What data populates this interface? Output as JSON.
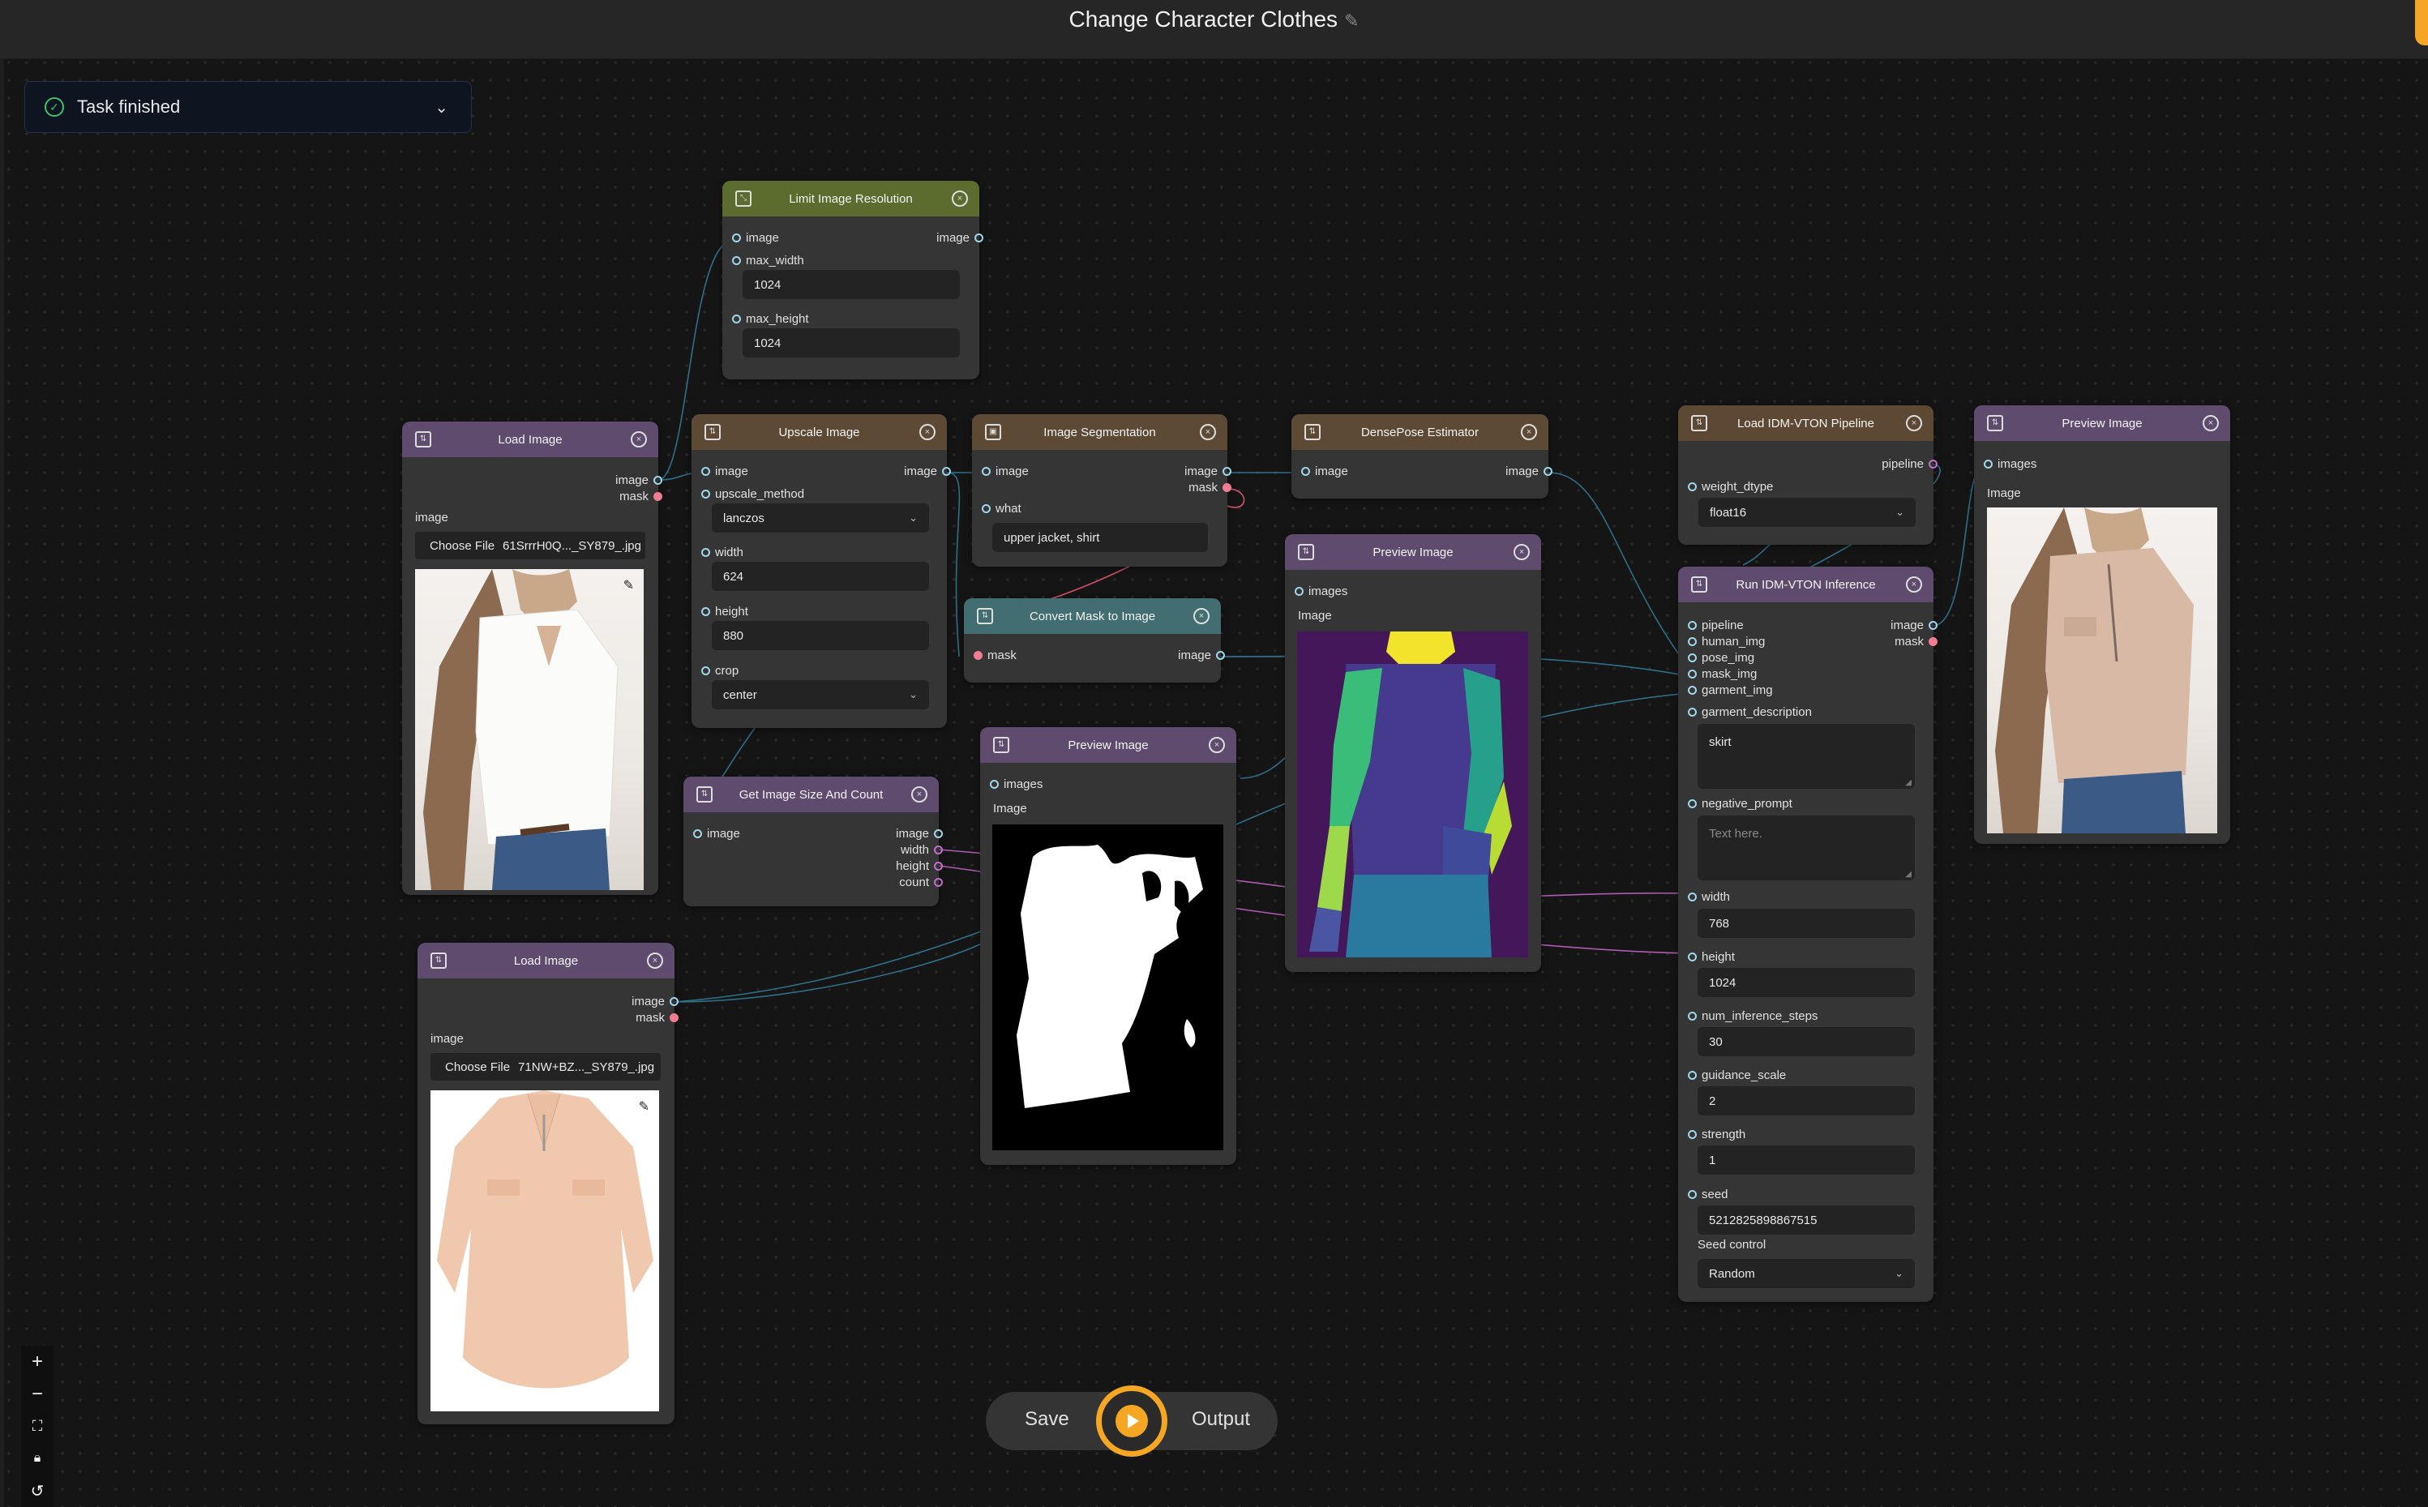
{
  "app": {
    "title": "Change Character Clothes"
  },
  "status": {
    "text": "Task finished"
  },
  "toolbar": {
    "save": "Save",
    "output": "Output"
  },
  "nodes": {
    "limit": {
      "title": "Limit Image Resolution",
      "in_image": "image",
      "out_image": "image",
      "max_width_label": "max_width",
      "max_width": "1024",
      "max_height_label": "max_height",
      "max_height": "1024"
    },
    "load1": {
      "title": "Load Image",
      "out_image": "image",
      "out_mask": "mask",
      "image_label": "image",
      "choose": "Choose File",
      "file": "61SrrrH0Q..._SY879_.jpg"
    },
    "upscale": {
      "title": "Upscale Image",
      "in_image": "image",
      "out_image": "image",
      "method_label": "upscale_method",
      "method": "lanczos",
      "width_label": "width",
      "width": "624",
      "height_label": "height",
      "height": "880",
      "crop_label": "crop",
      "crop": "center"
    },
    "seg": {
      "title": "Image Segmentation",
      "in_image": "image",
      "out_image": "image",
      "out_mask": "mask",
      "what_label": "what",
      "what": "upper jacket, shirt"
    },
    "dense": {
      "title": "DensePose Estimator",
      "in_image": "image",
      "out_image": "image"
    },
    "convert": {
      "title": "Convert Mask to Image",
      "in_mask": "mask",
      "out_image": "image"
    },
    "sizecount": {
      "title": "Get Image Size And Count",
      "in_image": "image",
      "out_image": "image",
      "out_width": "width",
      "out_height": "height",
      "out_count": "count"
    },
    "preview_mid": {
      "title": "Preview Image",
      "in_images": "images",
      "image_label": "Image"
    },
    "preview_dense": {
      "title": "Preview Image",
      "in_images": "images",
      "image_label": "Image"
    },
    "load2": {
      "title": "Load Image",
      "out_image": "image",
      "out_mask": "mask",
      "image_label": "image",
      "choose": "Choose File",
      "file": "71NW+BZ..._SY879_.jpg"
    },
    "pipeline": {
      "title": "Load IDM-VTON Pipeline",
      "out_pipeline": "pipeline",
      "dtype_label": "weight_dtype",
      "dtype": "float16"
    },
    "infer": {
      "title": "Run IDM-VTON Inference",
      "in_pipeline": "pipeline",
      "in_human": "human_img",
      "in_pose": "pose_img",
      "in_mask": "mask_img",
      "in_garment": "garment_img",
      "out_image": "image",
      "out_mask": "mask",
      "desc_label": "garment_description",
      "desc": "skirt",
      "neg_label": "negative_prompt",
      "neg_placeholder": "Text here.",
      "width_label": "width",
      "width": "768",
      "height_label": "height",
      "height": "1024",
      "steps_label": "num_inference_steps",
      "steps": "30",
      "guidance_label": "guidance_scale",
      "guidance": "2",
      "strength_label": "strength",
      "strength": "1",
      "seed_label": "seed",
      "seed": "5212825898867515",
      "seedctl_label": "Seed control",
      "seedctl": "Random"
    },
    "preview_right": {
      "title": "Preview Image",
      "in_images": "images",
      "image_label": "Image"
    }
  }
}
